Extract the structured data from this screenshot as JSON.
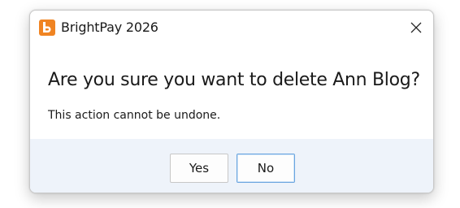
{
  "window": {
    "title": "BrightPay 2026",
    "app_icon": "brightpay-b-logo",
    "close_icon": "close-x-icon"
  },
  "dialog": {
    "main_instruction": "Are you sure you want to delete Ann Blog?",
    "content": "This action cannot be undone."
  },
  "buttons": {
    "yes_label": "Yes",
    "no_label": "No",
    "default": "No"
  },
  "colors": {
    "brand_orange": "#f08422",
    "footer_bg": "#eef3fa",
    "focus_border": "#6aa5df"
  }
}
